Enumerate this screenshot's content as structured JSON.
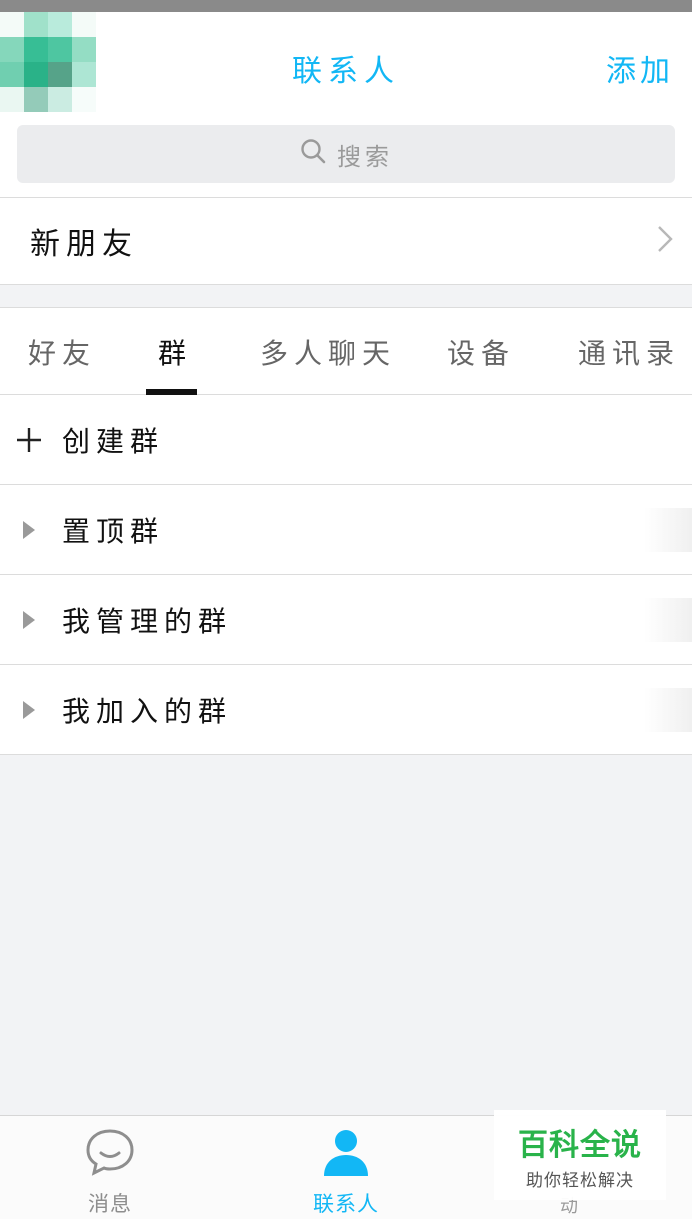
{
  "header": {
    "title": "联系人",
    "add_label": "添加"
  },
  "search": {
    "placeholder": "搜索"
  },
  "new_friends": {
    "label": "新朋友"
  },
  "tabs": [
    {
      "label": "好友"
    },
    {
      "label": "群",
      "active": true
    },
    {
      "label": "多人聊天"
    },
    {
      "label": "设备"
    },
    {
      "label": "通讯录"
    }
  ],
  "list": {
    "create_label": "创建群",
    "groups": [
      {
        "label": "置顶群"
      },
      {
        "label": "我管理的群"
      },
      {
        "label": "我加入的群"
      }
    ]
  },
  "bottom_nav": [
    {
      "label": "消息",
      "icon": "chat-bubble-icon"
    },
    {
      "label": "联系人",
      "icon": "person-icon",
      "active": true
    },
    {
      "label": "动",
      "icon": "star-icon"
    }
  ],
  "watermark": {
    "title": "百科全说",
    "subtitle": "助你轻松解决"
  },
  "colors": {
    "accent": "#12b7f5",
    "background": "#f2f3f5",
    "watermark_green": "#29b34a"
  }
}
